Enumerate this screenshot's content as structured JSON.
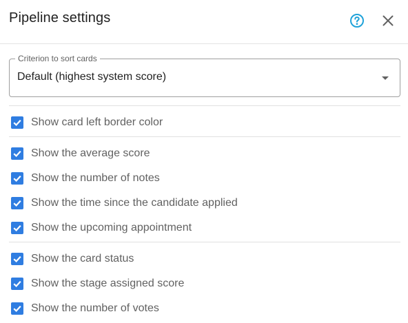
{
  "dialog": {
    "title": "Pipeline settings",
    "help_icon": "help-circle-icon",
    "close_icon": "close-icon",
    "accent_color": "#2f7de1"
  },
  "sort": {
    "legend": "Criterion to sort cards",
    "value": "Default (highest system score)"
  },
  "groups": [
    {
      "options": [
        {
          "label": "Show card left border color",
          "checked": true
        }
      ]
    },
    {
      "options": [
        {
          "label": "Show the average score",
          "checked": true
        },
        {
          "label": "Show the number of notes",
          "checked": true
        },
        {
          "label": "Show the time since the candidate applied",
          "checked": true
        },
        {
          "label": "Show the upcoming appointment",
          "checked": true
        }
      ]
    },
    {
      "options": [
        {
          "label": "Show the card status",
          "checked": true
        },
        {
          "label": "Show the stage assigned score",
          "checked": true
        },
        {
          "label": "Show the number of votes",
          "checked": true
        }
      ]
    }
  ]
}
